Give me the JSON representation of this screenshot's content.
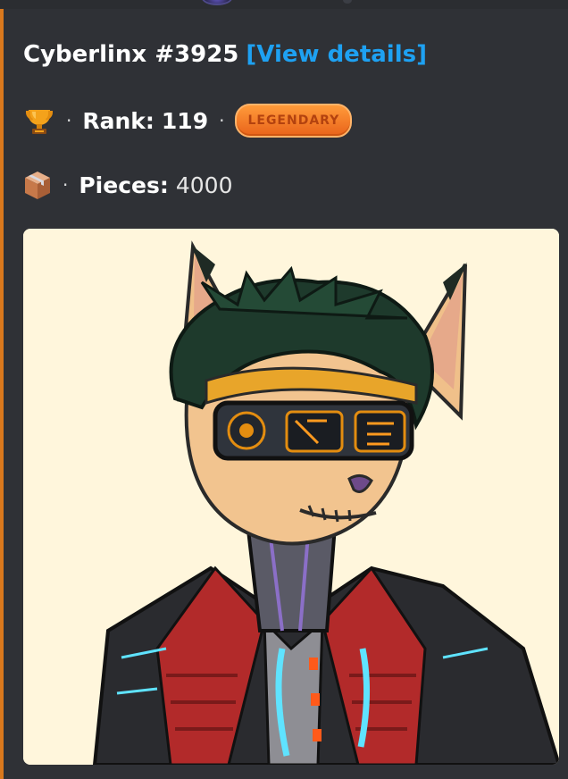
{
  "embed": {
    "accent_color": "#d9781d",
    "title": "Cyberlinx #3925",
    "details_link": "[View details]",
    "rank": {
      "icon": "trophy-icon",
      "separator": "·",
      "label": "Rank:",
      "value": "119",
      "badge": "LEGENDARY"
    },
    "pieces": {
      "icon": "package-icon",
      "separator": "·",
      "label": "Pieces:",
      "value": "4000"
    },
    "image": {
      "subject": "cyberlinx-artwork",
      "background_color": "#fff6dc"
    }
  }
}
